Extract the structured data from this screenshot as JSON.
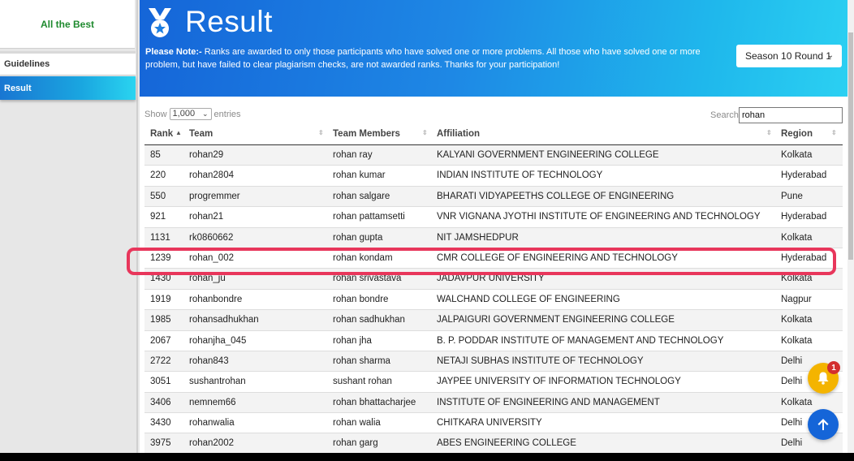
{
  "sidebar": {
    "brand": "All the Best",
    "items": [
      {
        "label": "Guidelines"
      },
      {
        "label": "Result"
      }
    ]
  },
  "header": {
    "title": "Result",
    "note_prefix": "Please Note:-",
    "note_text": " Ranks are awarded to only those participants who have solved one or more problems. All those who have solved one or more problem, but have failed to clear plagiarism checks, are not awarded ranks. Thanks for your participation!",
    "season_select": "Season 10 Round 1"
  },
  "controls": {
    "show_label": "Show",
    "entries_value": "1,000",
    "entries_label": "entries",
    "search_label": "Search:",
    "search_value": "rohan"
  },
  "table": {
    "columns": [
      "Rank",
      "Team",
      "Team Members",
      "Affiliation",
      "Region"
    ],
    "rows": [
      [
        "85",
        "rohan29",
        "rohan ray",
        "KALYANI GOVERNMENT ENGINEERING COLLEGE",
        "Kolkata"
      ],
      [
        "220",
        "rohan2804",
        "rohan kumar",
        "INDIAN INSTITUTE OF TECHNOLOGY",
        "Hyderabad"
      ],
      [
        "550",
        "progremmer",
        "rohan salgare",
        "BHARATI VIDYAPEETHS COLLEGE OF ENGINEERING",
        "Pune"
      ],
      [
        "921",
        "rohan21",
        "rohan pattamsetti",
        "VNR VIGNANA JYOTHI INSTITUTE OF ENGINEERING AND TECHNOLOGY",
        "Hyderabad"
      ],
      [
        "1131",
        "rk0860662",
        "rohan gupta",
        "NIT JAMSHEDPUR",
        "Kolkata"
      ],
      [
        "1239",
        "rohan_002",
        "rohan kondam",
        "CMR COLLEGE OF ENGINEERING AND TECHNOLOGY",
        "Hyderabad"
      ],
      [
        "1430",
        "rohan_ju",
        "rohan srivastava",
        "JADAVPUR UNIVERSITY",
        "Kolkata"
      ],
      [
        "1919",
        "rohanbondre",
        "rohan bondre",
        "WALCHAND COLLEGE OF ENGINEERING",
        "Nagpur"
      ],
      [
        "1985",
        "rohansadhukhan",
        "rohan sadhukhan",
        "JALPAIGURI GOVERNMENT ENGINEERING COLLEGE",
        "Kolkata"
      ],
      [
        "2067",
        "rohanjha_045",
        "rohan jha",
        "B. P. PODDAR INSTITUTE OF MANAGEMENT AND TECHNOLOGY",
        "Kolkata"
      ],
      [
        "2722",
        "rohan843",
        "rohan sharma",
        "NETAJI SUBHAS INSTITUTE OF TECHNOLOGY",
        "Delhi"
      ],
      [
        "3051",
        "sushantrohan",
        "sushant rohan",
        "JAYPEE UNIVERSITY OF INFORMATION TECHNOLOGY",
        "Delhi"
      ],
      [
        "3406",
        "nemnem66",
        "rohan bhattacharjee",
        "INSTITUTE OF ENGINEERING AND MANAGEMENT",
        "Kolkata"
      ],
      [
        "3430",
        "rohanwalia",
        "rohan walia",
        "CHITKARA UNIVERSITY",
        "Delhi"
      ],
      [
        "3975",
        "rohan2002",
        "rohan garg",
        "ABES ENGINEERING COLLEGE",
        "Delhi"
      ]
    ],
    "highlighted_rank": "1239"
  },
  "notifications": {
    "badge_count": "1"
  },
  "colors": {
    "accent": "#1e88e5",
    "highlight": "#e8365b",
    "bell": "#f4b400"
  },
  "icons": {
    "medal": "medal-icon",
    "bell": "bell-icon",
    "up": "arrow-up-icon"
  }
}
